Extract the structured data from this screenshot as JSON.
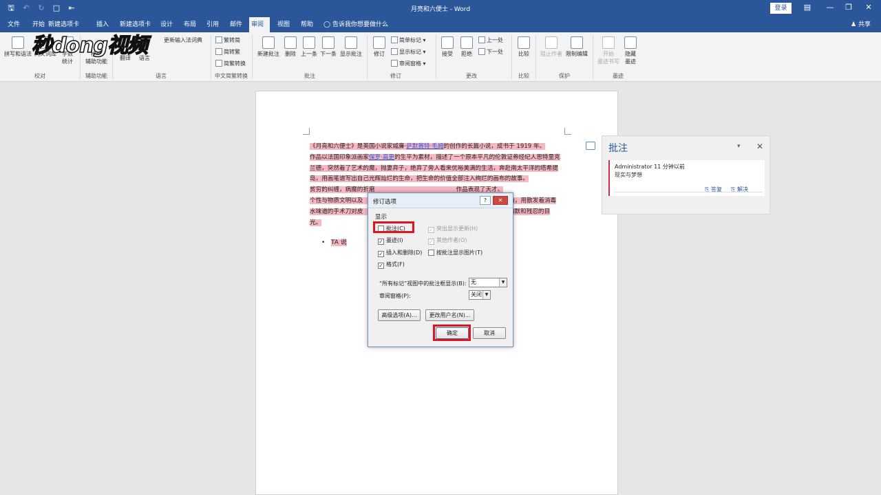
{
  "window": {
    "title": "月亮和六便士 - Word",
    "login_label": "登录",
    "qat_icons": [
      "save-icon",
      "undo-icon",
      "redo-icon",
      "new-doc-icon",
      "customize-icon"
    ]
  },
  "tabs": [
    {
      "label": "文件"
    },
    {
      "label": "开始"
    },
    {
      "label": "新建选项卡"
    },
    {
      "label": "插入"
    },
    {
      "label": "新建选项卡"
    },
    {
      "label": "设计"
    },
    {
      "label": "布局"
    },
    {
      "label": "引用"
    },
    {
      "label": "邮件"
    },
    {
      "label": "审阅",
      "active": true
    },
    {
      "label": "视图"
    },
    {
      "label": "帮助"
    }
  ],
  "tell_me": "告诉我你想要做什么",
  "share_label": "共享",
  "ribbon": {
    "proofing": {
      "spelling": "拼写和语法",
      "thesaurus": "同义词库",
      "wordcount_1": "字数",
      "wordcount_2": "统计",
      "label": "校对"
    },
    "accessibility": {
      "check_1": "检查",
      "check_2": "辅助功能",
      "label": "辅助功能"
    },
    "language": {
      "update_ime": "更新输入法词典",
      "translate": "翻译",
      "language": "语言",
      "label": "语言"
    },
    "chinese": {
      "t2s": "繁转简",
      "s2t": "简转繁",
      "convert": "简繁转换",
      "label": "中文简繁转换"
    },
    "comments": {
      "new": "新建批注",
      "delete": "删除",
      "prev": "上一条",
      "next": "下一条",
      "show": "显示批注",
      "label": "批注"
    },
    "tracking": {
      "track": "修订",
      "markup": "简单标记",
      "show_markup": "显示标记",
      "pane": "审阅窗格",
      "label": "修订"
    },
    "changes": {
      "accept": "接受",
      "reject": "拒绝",
      "prev": "上一处",
      "next": "下一处",
      "label": "更改"
    },
    "compare": {
      "compare": "比较",
      "label": "比较"
    },
    "protect": {
      "block": "阻止作者",
      "restrict": "限制编辑",
      "label": "保护"
    },
    "ink": {
      "start_1": "开始",
      "start_2": "墨迹书写",
      "hide_1": "隐藏",
      "hide_2": "墨迹",
      "label": "墨迹"
    }
  },
  "watermark": {
    "text": "秒dong视频"
  },
  "document": {
    "p1a": "《月亮和六便士》是英国小说家威廉·",
    "p1_link1": "萨默赛特·毛姆",
    "p1b": "的创作的长篇小说，成书于 1919 年。",
    "p1c": "作品以法国印象派画家",
    "p1_link2": "保罗·高更",
    "p1d": "的生平为素材，描述了一个原本平凡的伦敦证券经纪人思特里克兰德，突然着了艺术的魔，抛妻弃子，绝弃了旁人看来优裕美满的生活，奔赴南太平洋的塔希提岛，用画笔谱写出自己光辉灿烂的生命，把生命的价值全部注入绚烂的画布的故事。",
    "p2a": "贫穷的纠缠，病魔的折磨",
    "p2b": "作品表现了天才、",
    "p2c": "个性与物质文明以及",
    "p2d": "角，用散发着消毒",
    "p2e": "水味道的手术刀对皮",
    "p2f": "的幽默和残忍的目",
    "p2g": "光。",
    "bullet": "TA 说"
  },
  "comment_pane": {
    "title": "批注",
    "author": "Administrator",
    "time": "11 分钟以前",
    "body": "现实与梦想",
    "reply": "答复",
    "resolve": "解决"
  },
  "dialog": {
    "title": "修订选项",
    "help": "?",
    "section": "显示",
    "checkboxes": [
      {
        "label": "批注(C)",
        "checked": false
      },
      {
        "label": "墨迹(I)",
        "checked": true
      },
      {
        "label": "插入和删除(D)",
        "checked": true
      },
      {
        "label": "格式(F)",
        "checked": true
      },
      {
        "label": "突出显示更新(H)",
        "checked": true,
        "disabled": true
      },
      {
        "label": "其他作者(O)",
        "checked": true,
        "disabled": true
      },
      {
        "label": "按批注显示图片(T)",
        "checked": false
      }
    ],
    "balloons_label": "“所有标记”视图中的批注框显示(B):",
    "balloons_value": "无",
    "pane_label": "审阅窗格(P):",
    "pane_value": "关闭",
    "advanced_btn": "高级选项(A)...",
    "username_btn": "更改用户名(N)...",
    "ok_btn": "确定",
    "cancel_btn": "取消"
  }
}
